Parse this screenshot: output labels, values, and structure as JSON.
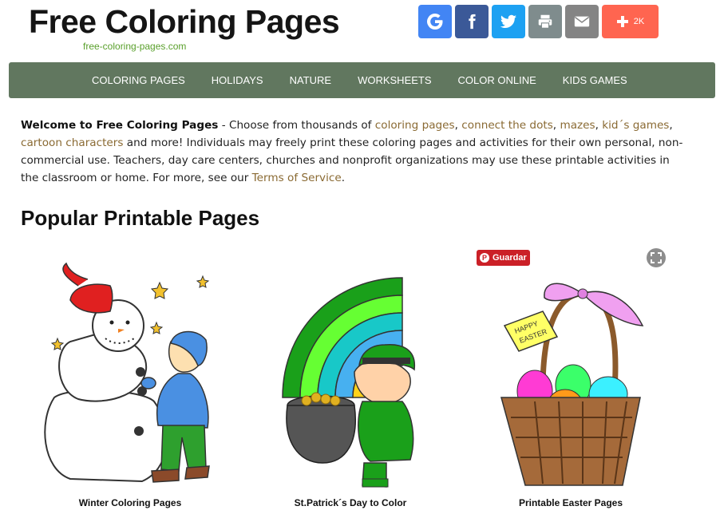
{
  "header": {
    "logo_title": "Free Coloring Pages",
    "logo_subtitle": "free-coloring-pages.com",
    "share_buttons": [
      {
        "icon": "google-icon",
        "color": "#4285f4"
      },
      {
        "icon": "facebook-icon",
        "color": "#3b5998"
      },
      {
        "icon": "twitter-icon",
        "color": "#1da1f2"
      },
      {
        "icon": "print-icon",
        "color": "#7f8c8d"
      },
      {
        "icon": "email-icon",
        "color": "#848484"
      },
      {
        "icon": "plus-icon",
        "color": "#ff6550",
        "count": "2K"
      }
    ]
  },
  "nav": {
    "background": "#61775f",
    "items": [
      "COLORING PAGES",
      "HOLIDAYS",
      "NATURE",
      "WORKSHEETS",
      "COLOR ONLINE",
      "KIDS GAMES"
    ]
  },
  "intro": {
    "bold_lead": "Welcome to Free Coloring Pages",
    "text_1": " - Choose from thousands of ",
    "link_1": "coloring pages",
    "sep_1": ", ",
    "link_2": "connect the dots",
    "sep_2": ", ",
    "link_3": "mazes",
    "sep_3": ", ",
    "link_4": "kid´s games",
    "sep_4": ", ",
    "link_5": "cartoon characters",
    "text_2": " and more! Individuals may freely print these coloring pages and activities for their own personal, non-commercial use. Teachers, day care centers, churches and nonprofit organizations may use these printable activities in the classroom or home. For more, see our ",
    "link_6": "Terms of Service",
    "text_3": ".",
    "link_color": "#8a6a33"
  },
  "section": {
    "title": "Popular Printable Pages"
  },
  "cards": [
    {
      "caption": "Winter Coloring Pages",
      "image": "snowman-and-child"
    },
    {
      "caption": "St.Patrick´s Day to Color",
      "image": "leprechaun-with-rainbow"
    },
    {
      "caption": "Printable Easter Pages",
      "image": "easter-basket"
    }
  ],
  "pinterest": {
    "label": "Guardar",
    "color": "#cb2027"
  }
}
